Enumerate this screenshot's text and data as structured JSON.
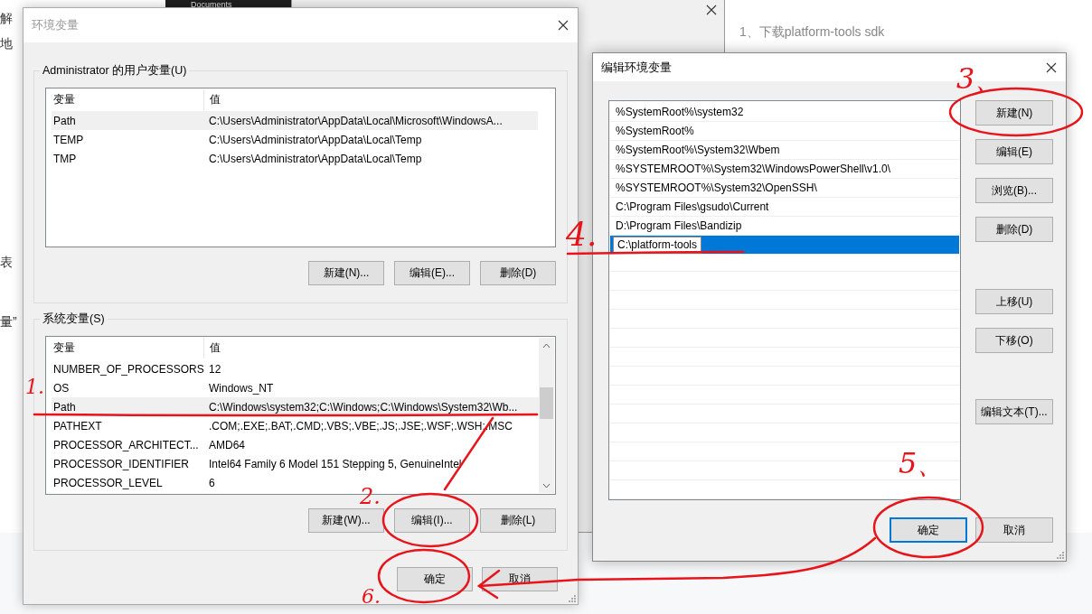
{
  "background_page": {
    "left_fragments": [
      "解",
      "地",
      "表",
      "量”"
    ],
    "step": "1、下载platform-tools sdk"
  },
  "background_window": {
    "explorer_item": "Documents"
  },
  "env_dialog": {
    "title": "环境变量",
    "user_group": {
      "label": "Administrator 的用户变量(U)",
      "columns": [
        "变量",
        "值"
      ],
      "rows": [
        {
          "name": "Path",
          "value": "C:\\Users\\Administrator\\AppData\\Local\\Microsoft\\WindowsA...",
          "selected": true
        },
        {
          "name": "TEMP",
          "value": "C:\\Users\\Administrator\\AppData\\Local\\Temp",
          "selected": false
        },
        {
          "name": "TMP",
          "value": "C:\\Users\\Administrator\\AppData\\Local\\Temp",
          "selected": false
        }
      ],
      "buttons": [
        "新建(N)...",
        "编辑(E)...",
        "删除(D)"
      ]
    },
    "system_group": {
      "label": "系统变量(S)",
      "columns": [
        "变量",
        "值"
      ],
      "rows": [
        {
          "name": "NUMBER_OF_PROCESSORS",
          "value": "12",
          "selected": false
        },
        {
          "name": "OS",
          "value": "Windows_NT",
          "selected": false
        },
        {
          "name": "Path",
          "value": "C:\\Windows\\system32;C:\\Windows;C:\\Windows\\System32\\Wb...",
          "selected": true
        },
        {
          "name": "PATHEXT",
          "value": ".COM;.EXE;.BAT;.CMD;.VBS;.VBE;.JS;.JSE;.WSF;.WSH;.MSC",
          "selected": false
        },
        {
          "name": "PROCESSOR_ARCHITECT...",
          "value": "AMD64",
          "selected": false
        },
        {
          "name": "PROCESSOR_IDENTIFIER",
          "value": "Intel64 Family 6 Model 151 Stepping 5, GenuineIntel",
          "selected": false
        },
        {
          "name": "PROCESSOR_LEVEL",
          "value": "6",
          "selected": false
        }
      ],
      "buttons": [
        "新建(W)...",
        "编辑(I)...",
        "删除(L)"
      ]
    },
    "buttons": [
      {
        "label": "确定",
        "focused": false
      },
      {
        "label": "取消",
        "focused": false
      }
    ]
  },
  "edit_dialog": {
    "title": "编辑环境变量",
    "entries": [
      {
        "text": "%SystemRoot%\\system32",
        "selected": false
      },
      {
        "text": "%SystemRoot%",
        "selected": false
      },
      {
        "text": "%SystemRoot%\\System32\\Wbem",
        "selected": false
      },
      {
        "text": "%SYSTEMROOT%\\System32\\WindowsPowerShell\\v1.0\\",
        "selected": false
      },
      {
        "text": "%SYSTEMROOT%\\System32\\OpenSSH\\",
        "selected": false
      },
      {
        "text": "C:\\Program Files\\gsudo\\Current",
        "selected": false
      },
      {
        "text": "D:\\Program Files\\Bandizip",
        "selected": false
      },
      {
        "text": "C:\\platform-tools",
        "selected": true
      }
    ],
    "side_buttons": [
      "新建(N)",
      "编辑(E)",
      "浏览(B)...",
      "删除(D)",
      "上移(U)",
      "下移(O)",
      "编辑文本(T)..."
    ],
    "buttons": [
      {
        "label": "确定",
        "focused": true
      },
      {
        "label": "取消",
        "focused": false
      }
    ]
  },
  "annotations": [
    {
      "label": "1."
    },
    {
      "label": "2."
    },
    {
      "label": "3、"
    },
    {
      "label": "4."
    },
    {
      "label": "5、"
    },
    {
      "label": "6."
    }
  ]
}
